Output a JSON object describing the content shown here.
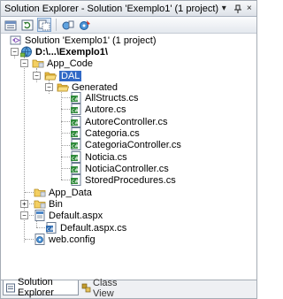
{
  "window": {
    "title": "Solution Explorer - Solution 'Exemplo1' (1 project)",
    "pin_glyph": "▾",
    "autohide_glyph": "⊣",
    "close_glyph": "×"
  },
  "toolbar": {
    "buttons": [
      {
        "name": "properties-icon",
        "active": false
      },
      {
        "name": "refresh-icon",
        "active": false
      },
      {
        "name": "show-all-files-icon",
        "active": true
      },
      {
        "name": "copy-website-icon",
        "active": false
      },
      {
        "name": "asp-net-configuration-icon",
        "active": false
      }
    ]
  },
  "tree": {
    "solution": "Solution 'Exemplo1' (1 project)",
    "project": "D:\\...\\Exemplo1\\",
    "app_code": "App_Code",
    "dal": "DAL",
    "generated": "Generated",
    "files": [
      "AllStructs.cs",
      "Autore.cs",
      "AutoreController.cs",
      "Categoria.cs",
      "CategoriaController.cs",
      "Noticia.cs",
      "NoticiaController.cs",
      "StoredProcedures.cs"
    ],
    "app_data": "App_Data",
    "bin": "Bin",
    "default_aspx": "Default.aspx",
    "default_aspx_cs": "Default.aspx.cs",
    "web_config": "web.config"
  },
  "tabs": {
    "solution_explorer": "Solution Explorer",
    "class_view": "Class View"
  },
  "colors": {
    "selection": "#3169c6",
    "folder": "#f3cf62",
    "cs_file": "#2f8a3a"
  }
}
